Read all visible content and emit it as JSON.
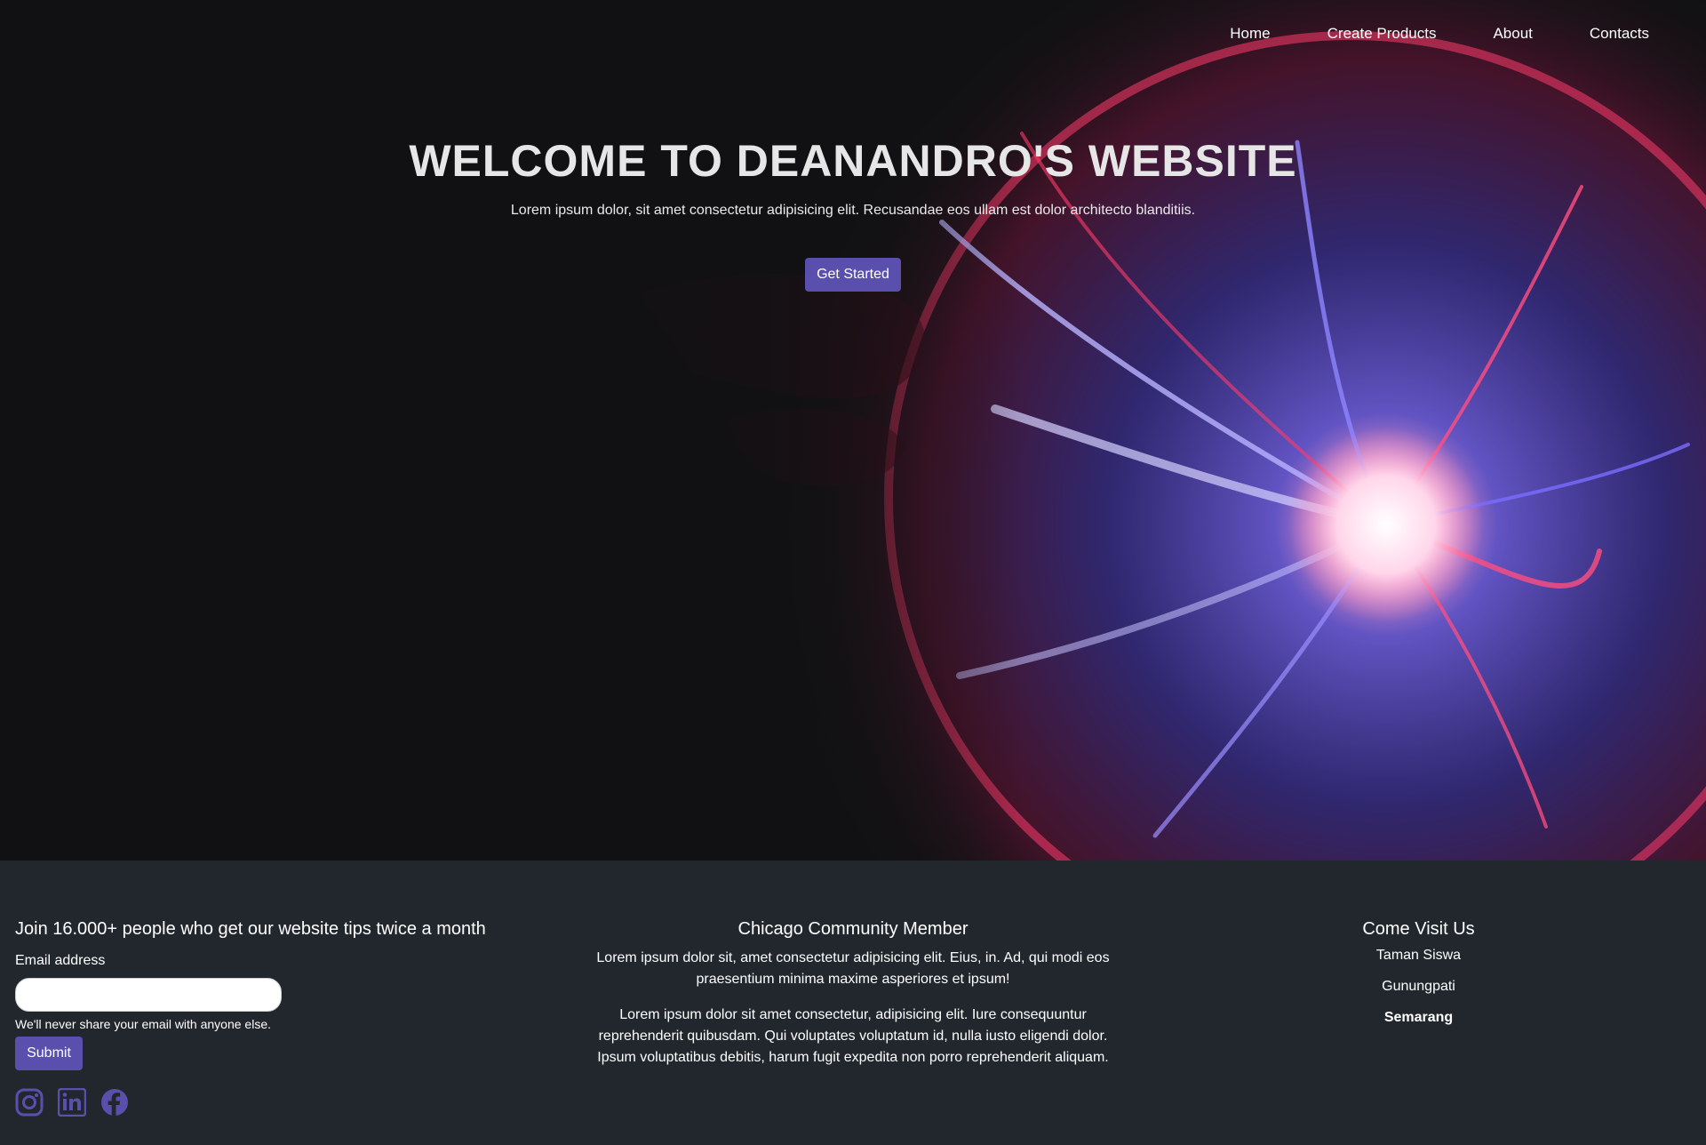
{
  "nav": {
    "items": [
      "Home",
      "Create Products",
      "About",
      "Contacts"
    ]
  },
  "hero": {
    "title": "WELCOME TO DEANANDRO'S WEBSITE",
    "subtitle": "Lorem ipsum dolor, sit amet consectetur adipisicing elit. Recusandae eos ullam est dolor architecto blanditiis.",
    "cta_label": "Get Started"
  },
  "footer": {
    "newsletter": {
      "heading": "Join 16.000+ people who get our website tips twice a month",
      "email_label": "Email address",
      "email_value": "",
      "help_text": "We'll never share your email with anyone else.",
      "submit_label": "Submit"
    },
    "socials": [
      "instagram-icon",
      "linkedin-icon",
      "facebook-icon"
    ],
    "community": {
      "heading": "Chicago Community Member",
      "para1": "Lorem ipsum dolor sit, amet consectetur adipisicing elit. Eius, in. Ad, qui modi eos praesentium minima maxime asperiores et ipsum!",
      "para2": "Lorem ipsum dolor sit amet consectetur, adipisicing elit. Iure consequuntur reprehenderit quibusdam. Qui voluptates voluptatum id, nulla iusto eligendi dolor. Ipsum voluptatibus debitis, harum fugit expedita non porro reprehenderit aliquam."
    },
    "visit": {
      "heading": "Come Visit Us",
      "locations": [
        "Taman Siswa",
        "Gunungpati",
        "Semarang"
      ]
    }
  },
  "colors": {
    "accent": "#5b4fae",
    "footer_bg": "#22262d",
    "hero_bg": "#111113"
  }
}
